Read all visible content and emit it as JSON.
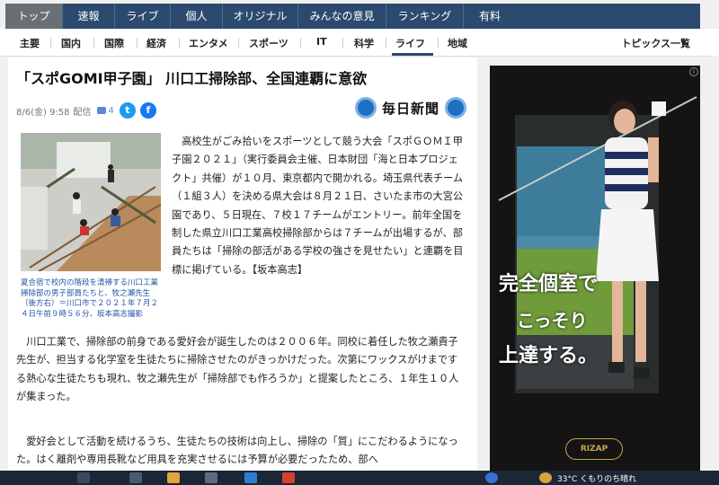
{
  "topnav": {
    "tabs": [
      "トップ",
      "速報",
      "ライブ",
      "個人",
      "オリジナル",
      "みんなの意見",
      "ランキング",
      "有料"
    ]
  },
  "subnav": {
    "items": [
      "主要",
      "国内",
      "国際",
      "経済",
      "エンタメ",
      "スポーツ",
      "IT",
      "科学",
      "ライフ",
      "地域"
    ],
    "active": "ライフ",
    "topics": "トピックス一覧"
  },
  "article": {
    "title": "「スポGOMI甲子園」 川口工掃除部、全国連覇に意欲",
    "date": "8/6(金) 9:58",
    "source_label": "配信",
    "comment_count": "4",
    "publisher": "毎日新聞",
    "caption": "夏合宿で校内の階段を清掃する川口工業掃除部の男子部員たちと、牧之瀬先生（後方右）＝川口市で２０２１年７月２４日午前９時５６分、坂本高志撮影",
    "lead": "高校生がごみ拾いをスポーツとして競う大会「スポＧＯＭＩ甲子園２０２１」（実行委員会主催、日本財団「海と日本プロジェクト」共催）が１０月、東京都内で開かれる。埼玉県代表チーム（１組３人）を決める県大会は８月２１日、さいたま市の大宮公園であり、５日現在、７校１７チームがエントリー。前年全国を制した県立川口工業高校掃除部からは７チームが出場するが、部員たちは「掃除の部活がある学校の強さを見せたい」と連覇を目標に掲げている。【坂本高志】",
    "para2": "川口工業で、掃除部の前身である愛好会が誕生したのは２００６年。同校に着任した牧之瀬貴子先生が、担当する化学室を生徒たちに掃除させたのがきっかけだった。次第にワックスがけまでする熱心な生徒たちも現れ、牧之瀬先生が「掃除部でも作ろうか」と提案したところ、１年生１０人が集まった。",
    "para3": "愛好会として活動を続けるうち、生徒たちの技術は向上し、掃除の「質」にこだわるようになった。はく離剤や専用長靴など用具を充実させるには予算が必要だったため、部へ"
  },
  "ad": {
    "line1": "完全個室で",
    "line2": "こっそり",
    "line3": "上達する。",
    "brand": "RIZAP"
  },
  "taskbar": {
    "weather": "33°C くもりのち晴れ"
  },
  "colors": {
    "nav_bg": "#2c4a6f",
    "nav_active": "#6a6f75",
    "caption": "#2354a6",
    "twitter": "#1d9bf0",
    "facebook": "#1877f2"
  }
}
